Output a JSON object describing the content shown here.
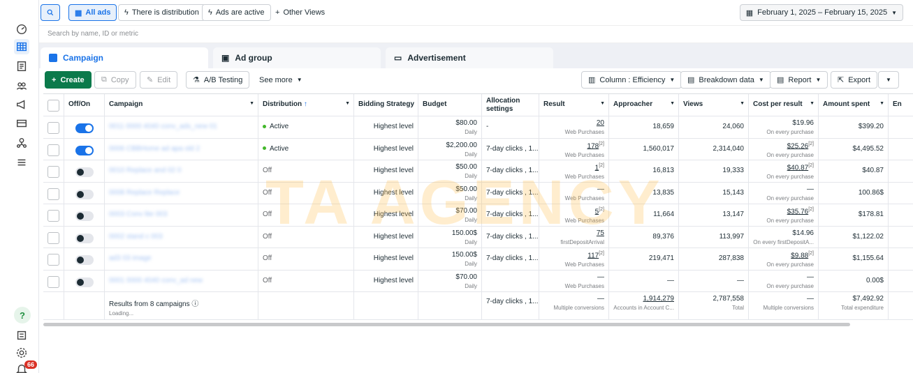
{
  "topbar": {
    "all_ads": "All ads",
    "distribution_filter": "There is distribution",
    "ads_active_filter": "Ads are active",
    "other_views": "Other Views",
    "date_range": "February 1, 2025 – February 15, 2025"
  },
  "search": {
    "placeholder": "Search by name, ID or metric"
  },
  "tabs": [
    {
      "label": "Campaign"
    },
    {
      "label": "Ad group"
    },
    {
      "label": "Advertisement"
    }
  ],
  "toolbar": {
    "create": "Create",
    "copy": "Copy",
    "edit": "Edit",
    "ab_testing": "A/B Testing",
    "see_more": "See more",
    "columns": "Column : Efficiency",
    "breakdown": "Breakdown data",
    "report": "Report",
    "export": "Export"
  },
  "table": {
    "headers": {
      "offon": "Off/On",
      "campaign": "Campaign",
      "distribution": "Distribution",
      "bidding": "Bidding Strategy",
      "budget": "Budget",
      "allocation": "Allocation settings",
      "result": "Result",
      "approacher": "Approacher",
      "views": "Views",
      "cpr": "Cost per result",
      "spent": "Amount spent",
      "end": "En"
    },
    "rows": [
      {
        "on": true,
        "name": "0011 0000 4040 conv_ads_new 01",
        "distribution": "Active",
        "active": true,
        "bidding": "Highest level",
        "budget": "$80.00",
        "budget_sub": "Daily",
        "allocation": "-",
        "result": "20",
        "result_sup": "",
        "result_sub": "Web Purchases",
        "approacher": "18,659",
        "views": "24,060",
        "cpr": "$19.96",
        "cpr_sup": "",
        "cpr_sub": "On every purchase",
        "spent": "$399.20"
      },
      {
        "on": true,
        "name": "0006 CBBHome ad apa old 2",
        "distribution": "Active",
        "active": true,
        "bidding": "Highest level",
        "budget": "$2,200.00",
        "budget_sub": "Daily",
        "allocation": "7-day clicks , 1...",
        "result": "178",
        "result_sup": "[2]",
        "result_sub": "Web Purchases",
        "approacher": "1,560,017",
        "views": "2,314,040",
        "cpr": "$25.26",
        "cpr_sup": "[2]",
        "cpr_sub": "On every purchase",
        "spent": "$4,495.52"
      },
      {
        "on": false,
        "name": "0010 Replace and 02 0",
        "distribution": "Off",
        "active": false,
        "bidding": "Highest level",
        "budget": "$50.00",
        "budget_sub": "Daily",
        "allocation": "7-day clicks , 1...",
        "result": "1",
        "result_sup": "[2]",
        "result_sub": "Web Purchases",
        "approacher": "16,813",
        "views": "19,333",
        "cpr": "$40.87",
        "cpr_sup": "[2]",
        "cpr_sub": "On every purchase",
        "spent": "$40.87"
      },
      {
        "on": false,
        "name": "0008 Replace Replace",
        "distribution": "Off",
        "active": false,
        "bidding": "Highest level",
        "budget": "$50.00",
        "budget_sub": "Daily",
        "allocation": "7-day clicks , 1...",
        "result": "—",
        "result_sup": "",
        "result_sub": "Web Purchases",
        "approacher": "13,835",
        "views": "15,143",
        "cpr": "—",
        "cpr_sup": "",
        "cpr_sub": "On every purchase",
        "spent": "100.86$"
      },
      {
        "on": false,
        "name": "0003 Conv lite 003",
        "distribution": "Off",
        "active": false,
        "bidding": "Highest level",
        "budget": "$70.00",
        "budget_sub": "Daily",
        "allocation": "7-day clicks , 1...",
        "result": "5",
        "result_sup": "[2]",
        "result_sub": "Web Purchases",
        "approacher": "11,664",
        "views": "13,147",
        "cpr": "$35.76",
        "cpr_sup": "[2]",
        "cpr_sub": "On every purchase",
        "spent": "$178.81"
      },
      {
        "on": false,
        "name": "0002 stand c 003",
        "distribution": "Off",
        "active": false,
        "bidding": "Highest level",
        "budget": "150.00$",
        "budget_sub": "Daily",
        "allocation": "7-day clicks , 1...",
        "result": "75",
        "result_sup": "",
        "result_sub": "firstDepositArrival",
        "approacher": "89,376",
        "views": "113,997",
        "cpr": "$14.96",
        "cpr_sup": "",
        "cpr_sub": "On every firstDepositA...",
        "spent": "$1,122.02"
      },
      {
        "on": false,
        "name": "ad3 03 image",
        "distribution": "Off",
        "active": false,
        "bidding": "Highest level",
        "budget": "150.00$",
        "budget_sub": "Daily",
        "allocation": "7-day clicks , 1...",
        "result": "117",
        "result_sup": "[2]",
        "result_sub": "Web Purchases",
        "approacher": "219,471",
        "views": "287,838",
        "cpr": "$9.88",
        "cpr_sup": "[2]",
        "cpr_sub": "On every purchase",
        "spent": "$1,155.64"
      },
      {
        "on": false,
        "name": "0001 0000 4040 conv_ad new",
        "distribution": "Off",
        "active": false,
        "bidding": "Highest level",
        "budget": "$70.00",
        "budget_sub": "Daily",
        "allocation": "",
        "result": "—",
        "result_sup": "",
        "result_sub": "Web Purchases",
        "approacher": "—",
        "views": "—",
        "cpr": "—",
        "cpr_sup": "",
        "cpr_sub": "On every purchase",
        "spent": "0.00$"
      }
    ],
    "summary": {
      "label": "Results from 8 campaigns",
      "loading": "Loading...",
      "allocation": "7-day clicks , 1...",
      "result": "—",
      "result_sub": "Multiple conversions",
      "approacher": "1,914,279",
      "approacher_sub": "Accounts in Account C...",
      "views": "2,787,558",
      "views_sub": "Total",
      "cpr": "—",
      "cpr_sub": "Multiple conversions",
      "spent": "$7,492.92",
      "spent_sub": "Total expenditure"
    }
  },
  "watermark": "TA AGENCY",
  "notifications_count": "66",
  "colors": {
    "accent": "#1a73e8",
    "create": "#0b7a4b",
    "active_dot": "#42b72a"
  }
}
